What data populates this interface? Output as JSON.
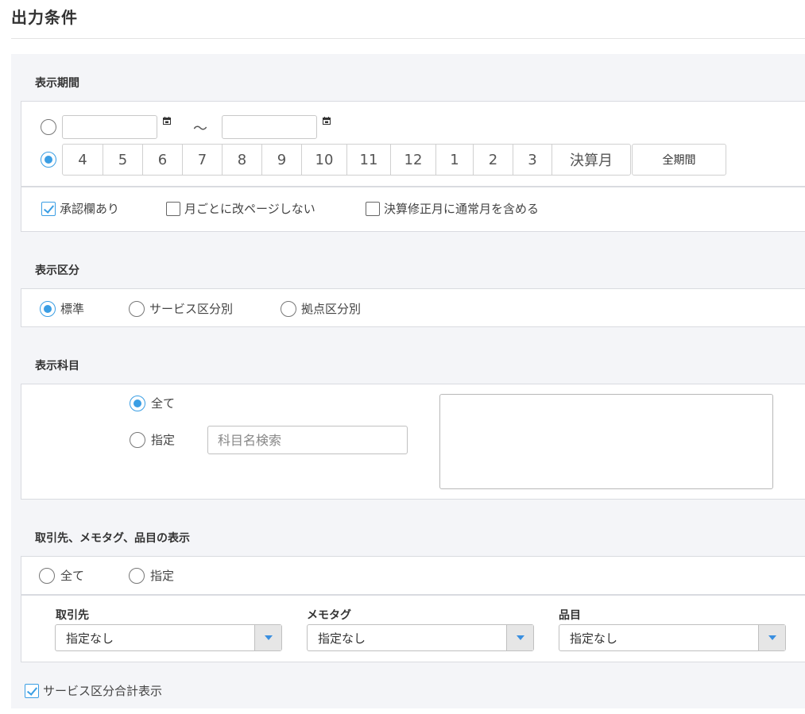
{
  "page": {
    "title": "出力条件"
  },
  "period": {
    "label": "表示期間",
    "range_separator": "～",
    "months": [
      "4",
      "5",
      "6",
      "7",
      "8",
      "9",
      "10",
      "11",
      "12",
      "1",
      "2",
      "3",
      "決算月"
    ],
    "all_period_label": "全期間",
    "range_radio_selected": false,
    "month_radio_selected": true,
    "options": {
      "approval": {
        "label": "承認欄あり",
        "checked": true
      },
      "no_page_break": {
        "label": "月ごとに改ページしない",
        "checked": false
      },
      "include_regular": {
        "label": "決算修正月に通常月を含める",
        "checked": false
      }
    }
  },
  "division": {
    "label": "表示区分",
    "options": [
      {
        "label": "標準",
        "selected": true
      },
      {
        "label": "サービス区分別",
        "selected": false
      },
      {
        "label": "拠点区分別",
        "selected": false
      }
    ]
  },
  "accounts": {
    "label": "表示科目",
    "all_label": "全て",
    "specify_label": "指定",
    "all_selected": true,
    "search_placeholder": "科目名検索"
  },
  "partners": {
    "label": "取引先、メモタグ、品目の表示",
    "all_label": "全て",
    "specify_label": "指定",
    "filters": [
      {
        "label": "取引先",
        "value": "指定なし"
      },
      {
        "label": "メモタグ",
        "value": "指定なし"
      },
      {
        "label": "品目",
        "value": "指定なし"
      }
    ]
  },
  "footer": {
    "service_total": {
      "label": "サービス区分合計表示",
      "checked": true
    }
  },
  "colors": {
    "accent": "#3a9ee4",
    "panel_bg": "#f4f5f8",
    "border": "#d9dbe0"
  }
}
